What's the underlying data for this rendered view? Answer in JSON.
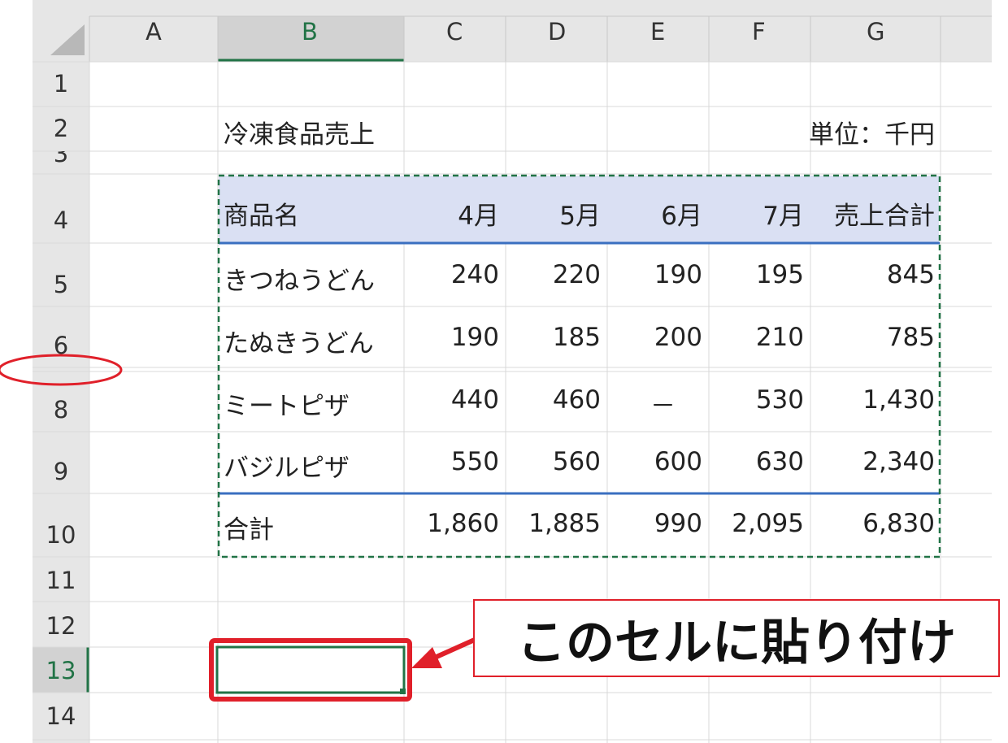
{
  "sheet": {
    "columns": [
      "A",
      "B",
      "C",
      "D",
      "E",
      "F",
      "G"
    ],
    "rows": [
      "1",
      "2",
      "3",
      "4",
      "5",
      "6",
      "8",
      "9",
      "10",
      "11",
      "12",
      "13",
      "14"
    ],
    "selected_column": "B",
    "selected_row": "13"
  },
  "table": {
    "title": "冷凍食品売上",
    "unit": "単位：千円",
    "headers": [
      "商品名",
      "4月",
      "5月",
      "6月",
      "7月",
      "売上合計"
    ],
    "rows": [
      {
        "name": "きつねうどん",
        "values": [
          "240",
          "220",
          "190",
          "195",
          "845"
        ]
      },
      {
        "name": "たぬきうどん",
        "values": [
          "190",
          "185",
          "200",
          "210",
          "785"
        ]
      },
      {
        "name": "ミートピザ",
        "values": [
          "440",
          "460",
          "－",
          "530",
          "1,430"
        ]
      },
      {
        "name": "バジルピザ",
        "values": [
          "550",
          "560",
          "600",
          "630",
          "2,340"
        ]
      }
    ],
    "total": {
      "name": "合計",
      "values": [
        "1,860",
        "1,885",
        "990",
        "2,095",
        "6,830"
      ]
    }
  },
  "annotation": {
    "callout_text": "このセルに貼り付け",
    "accent_color": "#e0202a",
    "border_color": "#217346"
  }
}
